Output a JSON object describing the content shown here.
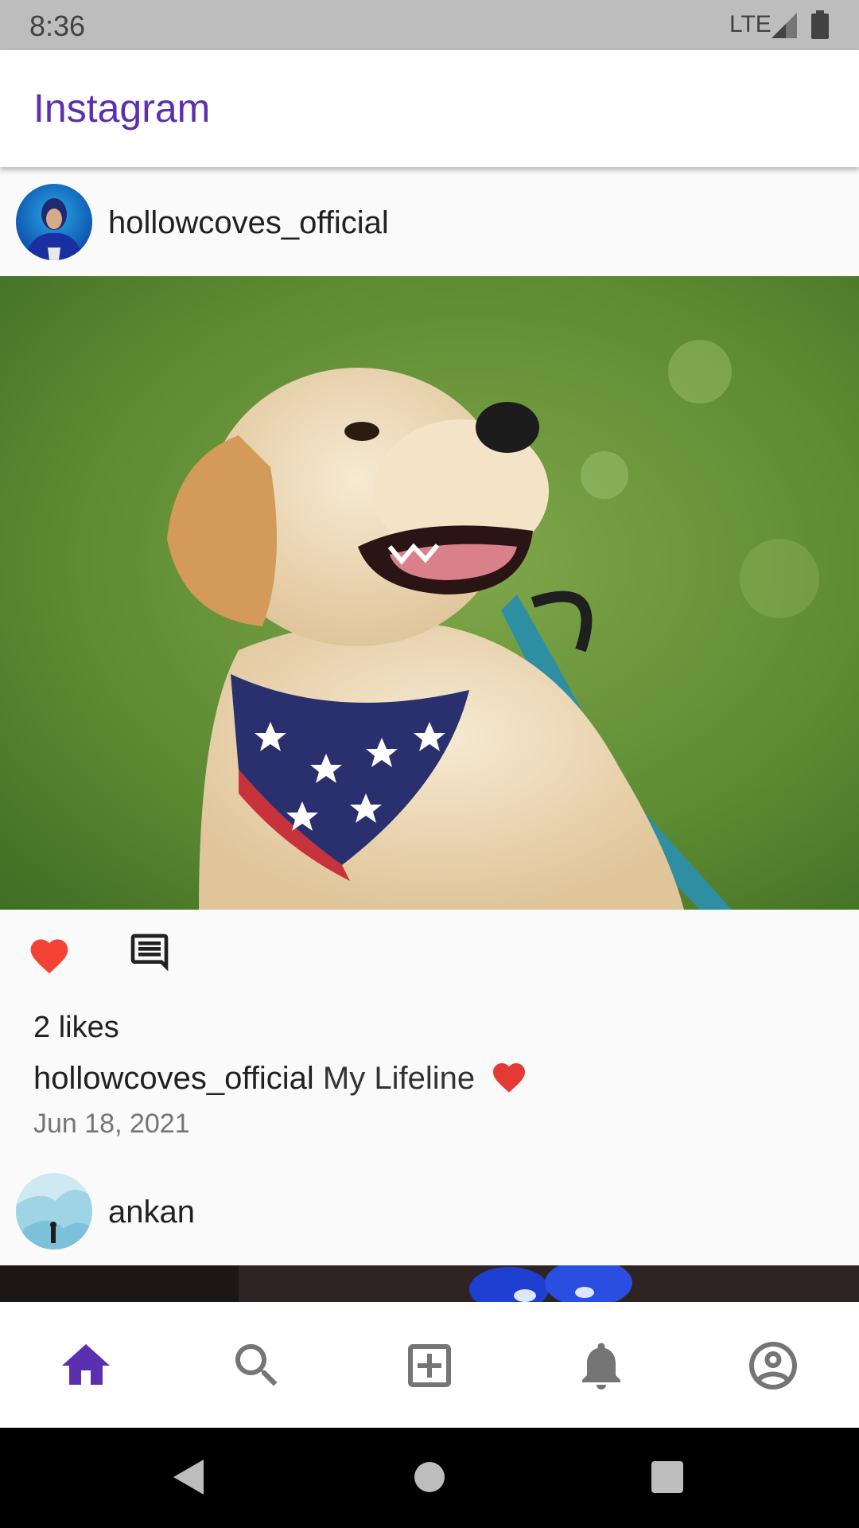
{
  "status_bar": {
    "time": "8:36",
    "network": "LTE",
    "icons": [
      "signal-icon",
      "battery-icon"
    ]
  },
  "app_bar": {
    "title": "Instagram",
    "title_color": "#5b2fb0"
  },
  "feed": {
    "posts": [
      {
        "username": "hollowcoves_official",
        "likes": "2 likes",
        "caption_user": "hollowcoves_official",
        "caption_text": "My Lifeline",
        "date": "Jun 18, 2021",
        "liked": true,
        "image": "golden-retriever-with-flag-bandana"
      },
      {
        "username": "ankan",
        "image": "blue-flowers"
      }
    ],
    "like_color": "#f44336"
  },
  "bottom_nav": {
    "items": [
      "home-icon",
      "search-icon",
      "add-post-icon",
      "notifications-icon",
      "profile-icon"
    ],
    "active": "home-icon",
    "active_color": "#5b2fb0",
    "inactive_color": "#757575"
  },
  "system_nav": {
    "buttons": [
      "back-icon",
      "home-circle-icon",
      "recents-icon"
    ]
  }
}
